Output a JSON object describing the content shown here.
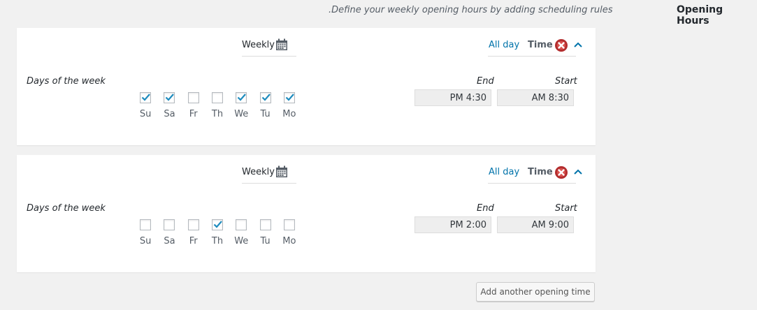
{
  "header": {
    "title": "Opening Hours",
    "description": ".Define your weekly opening hours by adding scheduling rules"
  },
  "icons": {
    "calendar": "calendar-icon",
    "delete": "delete-icon",
    "collapse": "chevron-up-icon",
    "checkmark": "checkmark-icon"
  },
  "colors": {
    "link": "#0073aa",
    "delete_icon": "#b32d2e",
    "checkmark": "#1e8cbe",
    "card_bg": "#ffffff",
    "page_bg": "#f1f1f1"
  },
  "rules": [
    {
      "frequency": "Weekly",
      "all_day_label": "All day",
      "time_label": "Time",
      "days_label": "Days of the week",
      "days": [
        {
          "label": "Su",
          "checked": true
        },
        {
          "label": "Sa",
          "checked": true
        },
        {
          "label": "Fr",
          "checked": false
        },
        {
          "label": "Th",
          "checked": false
        },
        {
          "label": "We",
          "checked": true
        },
        {
          "label": "Tu",
          "checked": true
        },
        {
          "label": "Mo",
          "checked": true
        }
      ],
      "end_label": "End",
      "start_label": "Start",
      "end_time": "PM 4:30",
      "start_time": "AM 8:30"
    },
    {
      "frequency": "Weekly",
      "all_day_label": "All day",
      "time_label": "Time",
      "days_label": "Days of the week",
      "days": [
        {
          "label": "Su",
          "checked": false
        },
        {
          "label": "Sa",
          "checked": false
        },
        {
          "label": "Fr",
          "checked": false
        },
        {
          "label": "Th",
          "checked": true
        },
        {
          "label": "We",
          "checked": false
        },
        {
          "label": "Tu",
          "checked": false
        },
        {
          "label": "Mo",
          "checked": false
        }
      ],
      "end_label": "End",
      "start_label": "Start",
      "end_time": "PM 2:00",
      "start_time": "AM 9:00"
    }
  ],
  "add_button_label": "Add another opening time"
}
